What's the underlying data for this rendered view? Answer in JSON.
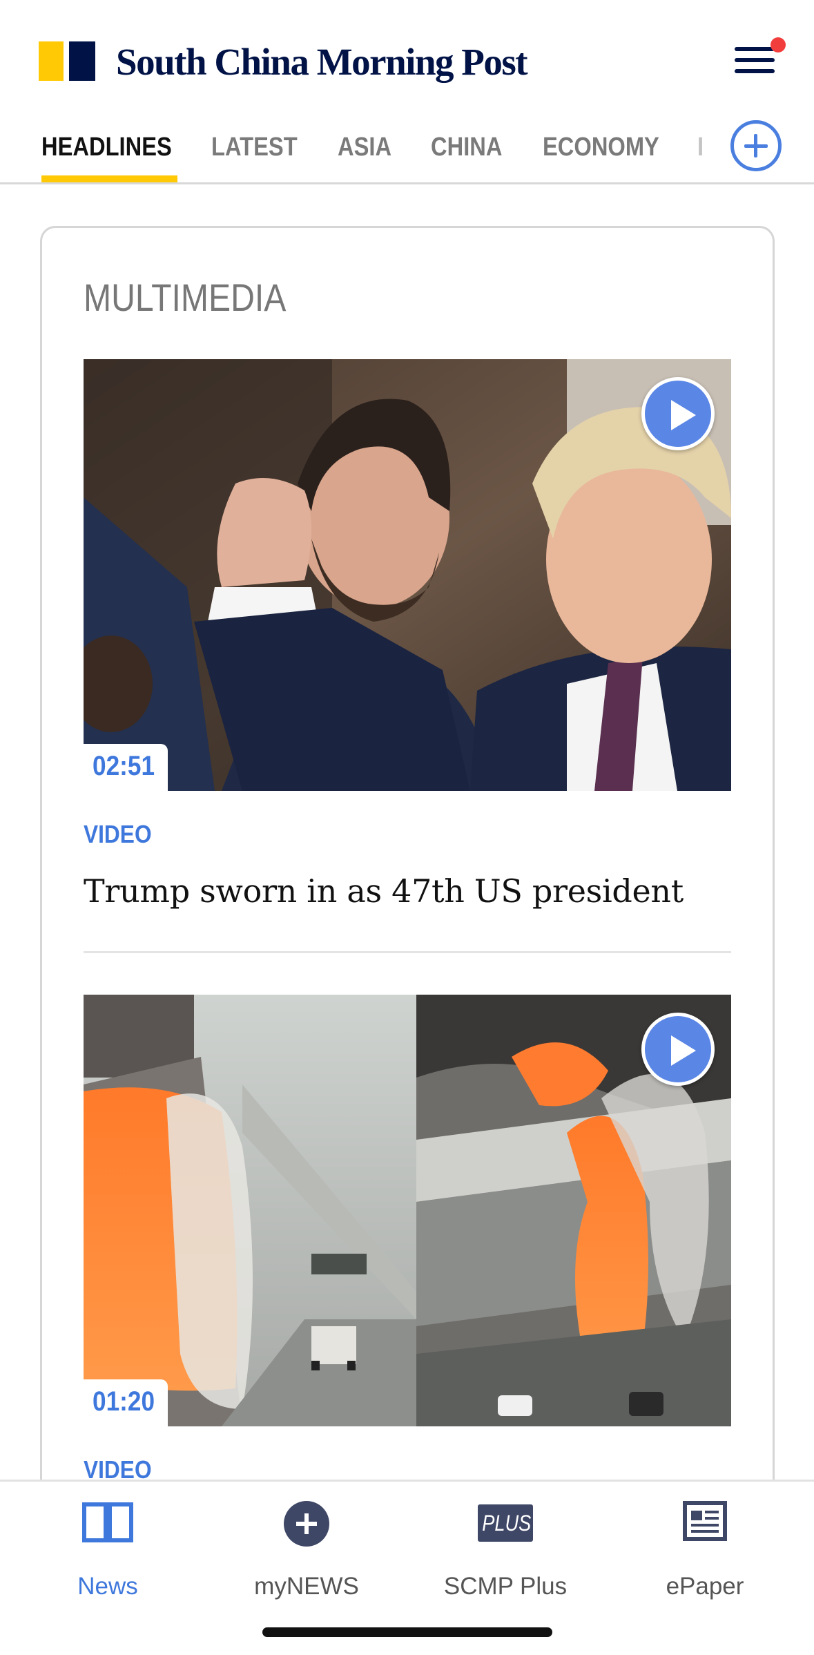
{
  "header": {
    "logo_text": "South China Morning Post",
    "notification_dot": true,
    "brand_colors": {
      "yellow": "#ffca05",
      "navy": "#001246",
      "accent_blue": "#3f78dc"
    }
  },
  "tabs": {
    "items": [
      {
        "label": "HEADLINES",
        "active": true
      },
      {
        "label": "LATEST",
        "active": false
      },
      {
        "label": "ASIA",
        "active": false
      },
      {
        "label": "CHINA",
        "active": false
      },
      {
        "label": "ECONOMY",
        "active": false
      },
      {
        "label": "I",
        "active": false
      }
    ],
    "add_icon": "plus-circle-icon"
  },
  "section": {
    "title": "MULTIMEDIA",
    "stories": [
      {
        "duration": "02:51",
        "kicker": "VIDEO",
        "headline": "Trump sworn in as 47th US president",
        "play_icon": "play-icon"
      },
      {
        "duration": "01:20",
        "kicker": "VIDEO",
        "headline": "",
        "play_icon": "play-icon"
      }
    ]
  },
  "bottom_nav": {
    "items": [
      {
        "label": "News",
        "icon": "book-icon",
        "active": true
      },
      {
        "label": "myNEWS",
        "icon": "plus-circle-icon",
        "active": false
      },
      {
        "label": "SCMP Plus",
        "icon": "plus-badge-icon",
        "badge_text": "PLUS",
        "active": false
      },
      {
        "label": "ePaper",
        "icon": "newspaper-icon",
        "active": false
      }
    ]
  }
}
